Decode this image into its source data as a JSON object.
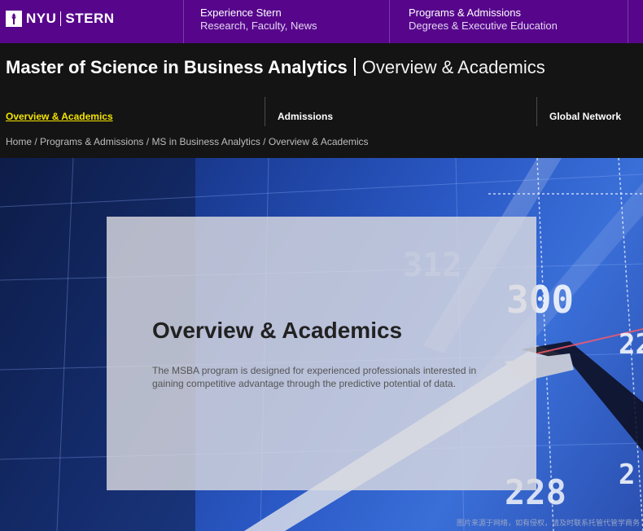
{
  "brand": {
    "nyu": "NYU",
    "stern": "STERN"
  },
  "top_nav": [
    {
      "title": "Experience Stern",
      "subtitle": "Research, Faculty, News"
    },
    {
      "title": "Programs & Admissions",
      "subtitle": "Degrees & Executive Education"
    }
  ],
  "header": {
    "program": "Master of Science in Business Analytics",
    "section": "Overview & Academics"
  },
  "sub_nav": [
    {
      "label": "Overview & Academics",
      "active": true
    },
    {
      "label": "Admissions",
      "active": false
    },
    {
      "label": "Global Network",
      "active": false
    }
  ],
  "breadcrumb": [
    "Home",
    "Programs & Admissions",
    "MS in Business Analytics",
    "Overview & Academics"
  ],
  "hero": {
    "heading": "Overview & Academics",
    "description": "The MSBA program is designed for experienced professionals interested in gaining competitive advantage through the predictive potential of data.",
    "image_text": [
      "312",
      "300",
      "22",
      "228",
      "2"
    ],
    "watermark": "图片来源于网络，如有侵权，请及时联系托管代管学商务"
  },
  "colors": {
    "brand_purple": "#57068c",
    "active_link": "#f5e400",
    "header_bg": "#141414"
  }
}
